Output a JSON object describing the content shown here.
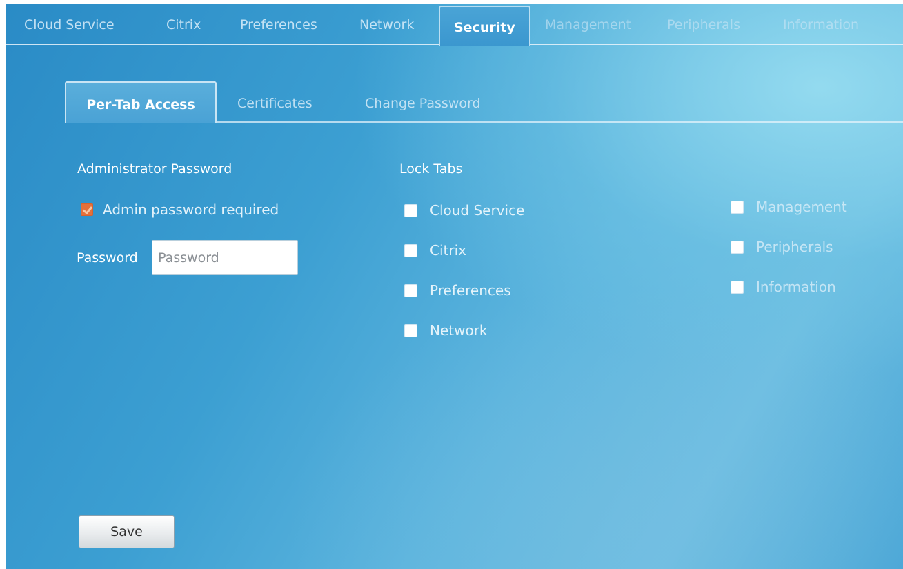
{
  "top_tabs": [
    "Cloud Service",
    "Citrix",
    "Preferences",
    "Network",
    "Security",
    "Management",
    "Peripherals",
    "Information"
  ],
  "active_top_tab": "Security",
  "sub_tabs": [
    "Per-Tab Access",
    "Certificates",
    "Change Password"
  ],
  "active_sub_tab": "Per-Tab Access",
  "admin": {
    "section_title": "Administrator Password",
    "required_label": "Admin password required",
    "required_checked": true,
    "password_label": "Password",
    "password_placeholder": "Password",
    "password_value": ""
  },
  "lock_tabs": {
    "title": "Lock Tabs",
    "left_column": [
      {
        "label": "Cloud Service",
        "checked": false
      },
      {
        "label": "Citrix",
        "checked": false
      },
      {
        "label": "Preferences",
        "checked": false
      },
      {
        "label": "Network",
        "checked": false
      }
    ],
    "right_column": [
      {
        "label": "Management",
        "checked": false
      },
      {
        "label": "Peripherals",
        "checked": false
      },
      {
        "label": "Information",
        "checked": false
      }
    ]
  },
  "save_label": "Save",
  "colors": {
    "accent_orange": "#e5703a",
    "background_blue": "#3c9fd2"
  }
}
